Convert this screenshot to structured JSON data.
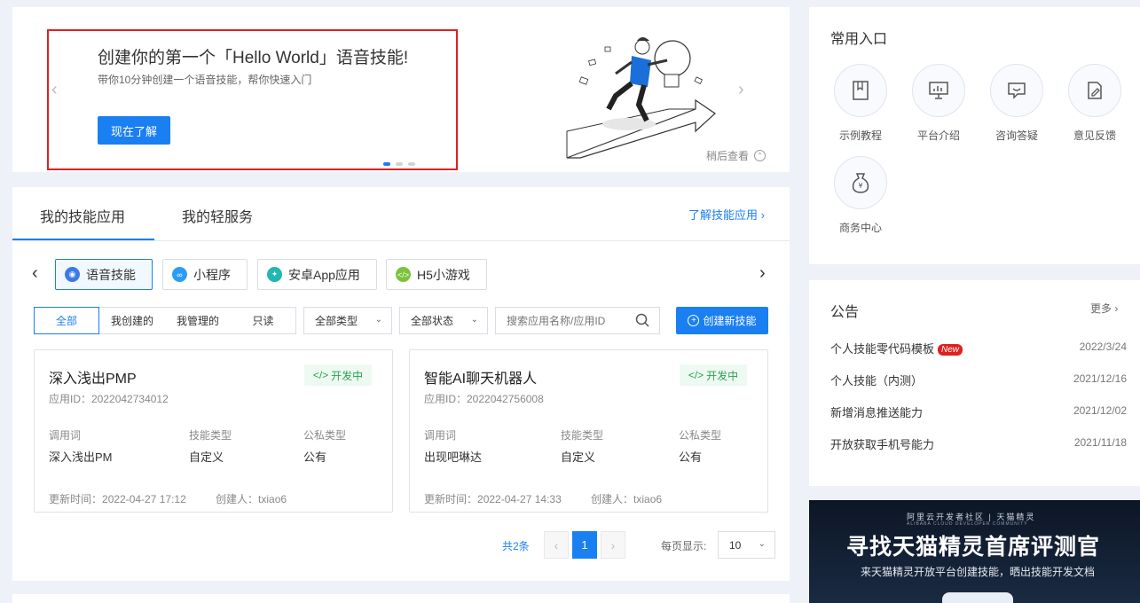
{
  "banner": {
    "title": "创建你的第一个「Hello World」语音技能!",
    "subtitle": "带你10分钟创建一个语音技能，帮你快速入门",
    "cta": "现在了解",
    "later": "稍后查看",
    "prev_icon": "chevron-left-icon",
    "next_icon": "chevron-right-icon"
  },
  "skills": {
    "tabs": [
      {
        "label": "我的技能应用",
        "active": true
      },
      {
        "label": "我的轻服务",
        "active": false
      }
    ],
    "learn_link": "了解技能应用",
    "categories": [
      {
        "label": "语音技能",
        "icon": "voice-icon",
        "color": "#3b7be8",
        "active": true
      },
      {
        "label": "小程序",
        "icon": "miniprogram-icon",
        "color": "#2a9df4",
        "active": false
      },
      {
        "label": "安卓App应用",
        "icon": "android-icon",
        "color": "#20b8b0",
        "active": false
      },
      {
        "label": "H5小游戏",
        "icon": "code-icon",
        "color": "#7cc23a",
        "active": false
      }
    ],
    "filters": {
      "segments": [
        {
          "label": "全部",
          "active": true
        },
        {
          "label": "我创建的",
          "active": false
        },
        {
          "label": "我管理的",
          "active": false
        },
        {
          "label": "只读",
          "active": false
        }
      ],
      "type_select": "全部类型",
      "status_select": "全部状态",
      "search_placeholder": "搜索应用名称/应用ID",
      "create_button": "创建新技能"
    },
    "field_labels": {
      "invoke": "调用词",
      "skill_type": "技能类型",
      "visibility": "公私类型",
      "updated": "更新时间：",
      "creator": "创建人："
    },
    "apps": [
      {
        "name": "深入浅出PMP",
        "app_id": "应用ID：2022042734012",
        "status": "开发中",
        "invoke": "深入浅出PM",
        "skill_type": "自定义",
        "visibility": "公有",
        "updated": "2022-04-27 17:12",
        "creator": "txiao6"
      },
      {
        "name": "智能AI聊天机器人",
        "app_id": "应用ID：2022042756008",
        "status": "开发中",
        "invoke": "出现吧琳达",
        "skill_type": "自定义",
        "visibility": "公有",
        "updated": "2022-04-27 14:33",
        "creator": "txiao6"
      }
    ],
    "pagination": {
      "total": "共2条",
      "current_page": "1",
      "per_page_label": "每页显示:",
      "per_page": "10"
    }
  },
  "quick_entry": {
    "title": "常用入口",
    "items": [
      {
        "label": "示例教程",
        "icon": "book-icon"
      },
      {
        "label": "平台介绍",
        "icon": "presentation-icon"
      },
      {
        "label": "咨询答疑",
        "icon": "chat-icon"
      },
      {
        "label": "意见反馈",
        "icon": "feedback-icon"
      },
      {
        "label": "商务中心",
        "icon": "money-bag-icon"
      }
    ]
  },
  "notice": {
    "title": "公告",
    "more": "更多",
    "items": [
      {
        "text": "个人技能零代码模板",
        "badge": "New",
        "date": "2022/3/24"
      },
      {
        "text": "个人技能（内测）",
        "badge": "",
        "date": "2021/12/16"
      },
      {
        "text": "新增消息推送能力",
        "badge": "",
        "date": "2021/12/02"
      },
      {
        "text": "开放获取手机号能力",
        "badge": "",
        "date": "2021/11/18"
      }
    ]
  },
  "promo": {
    "top": "阿里云开发者社区 | 天猫精灵",
    "sub_top": "ALIBABA CLOUD DEVELOPER COMMUNITY",
    "headline": "寻找天猫精灵首席评测官",
    "tagline": "来天猫精灵开放平台创建技能，晒出技能开发文档"
  },
  "colors": {
    "primary": "#1a7ff0",
    "highlight_border": "#e02020",
    "status_green": "#2aa150",
    "new_badge": "#e02020"
  }
}
